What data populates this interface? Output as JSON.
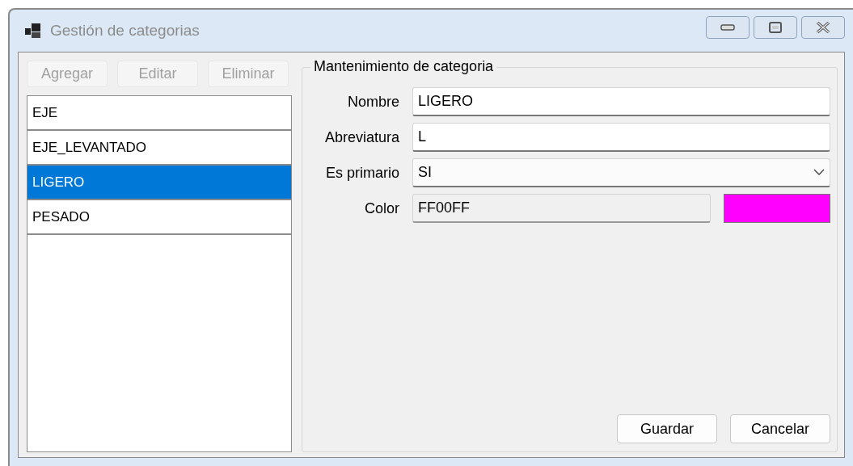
{
  "window": {
    "title": "Gestión de categorias"
  },
  "toolbar": [
    {
      "label": "Agregar",
      "disabled": true
    },
    {
      "label": "Editar",
      "disabled": true
    },
    {
      "label": "Eliminar",
      "disabled": true
    }
  ],
  "list": [
    {
      "label": "EJE",
      "selected": false
    },
    {
      "label": "EJE_LEVANTADO",
      "selected": false
    },
    {
      "label": "LIGERO",
      "selected": true
    },
    {
      "label": "PESADO",
      "selected": false
    }
  ],
  "group": {
    "title": "Mantenimiento de categoria",
    "fields": [
      {
        "kind": "text",
        "label": "Nombre",
        "value": "LIGERO"
      },
      {
        "kind": "text",
        "label": "Abreviatura",
        "value": "L"
      },
      {
        "kind": "dropdown",
        "label": "Es primario",
        "value": "SI"
      },
      {
        "kind": "color",
        "label": "Color",
        "value": "FF00FF",
        "color": "#ff00ff"
      }
    ]
  },
  "buttons": [
    "Guardar",
    "Cancelar"
  ]
}
